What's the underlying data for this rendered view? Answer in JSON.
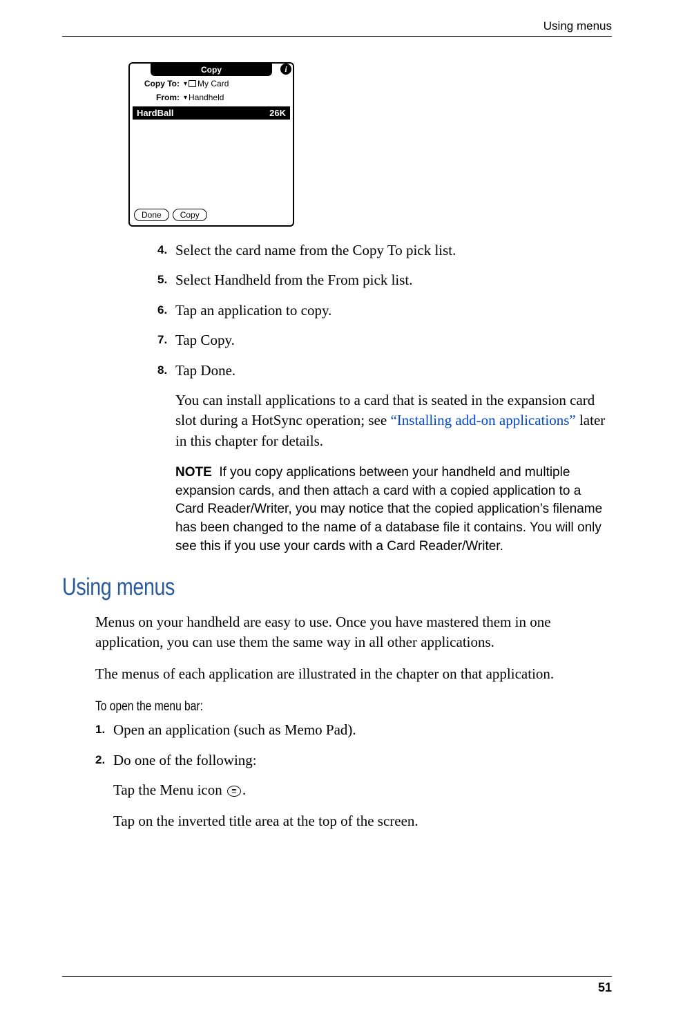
{
  "header": {
    "section": "Using menus"
  },
  "screenshot": {
    "title": "Copy",
    "copyto_label": "Copy To:",
    "copyto_value": "My Card",
    "from_label": "From:",
    "from_value": "Handheld",
    "item_name": "HardBall",
    "item_size": "26K",
    "done_btn": "Done",
    "copy_btn": "Copy"
  },
  "steps1": {
    "s4": {
      "num": "4.",
      "text": "Select the card name from the Copy To pick list."
    },
    "s5": {
      "num": "5.",
      "text": "Select Handheld from the From pick list."
    },
    "s6": {
      "num": "6.",
      "text": "Tap an application to copy."
    },
    "s7": {
      "num": "7.",
      "text": "Tap Copy."
    },
    "s8": {
      "num": "8.",
      "text": "Tap Done."
    }
  },
  "para_install_pre": "You can install applications to a card that is seated in the expansion card slot during a HotSync operation; see ",
  "para_install_link": "“Installing add-on applications”",
  "para_install_post": " later in this chapter for details.",
  "note": {
    "label": "NOTE",
    "text": "If you copy applications between your handheld and multiple expansion cards, and then attach a card with a copied application to a Card Reader/Writer, you may notice that the copied application’s filename has been changed to the name of a database file it contains. You will only see this if you use your cards with a Card Reader/Writer."
  },
  "heading": "Using menus",
  "body1": "Menus on your handheld are easy to use. Once you have mastered them in one application, you can use them the same way in all other applications.",
  "body2": "The menus of each application are illustrated in the chapter on that application.",
  "subheading": "To open the menu bar:",
  "steps2": {
    "s1": {
      "num": "1.",
      "text": "Open an application (such as Memo Pad)."
    },
    "s2": {
      "num": "2.",
      "text": "Do one of the following:"
    }
  },
  "sub1_pre": "Tap the Menu icon ",
  "sub1_post": ".",
  "sub2": "Tap on the inverted title area at the top of the screen.",
  "page_number": "51"
}
